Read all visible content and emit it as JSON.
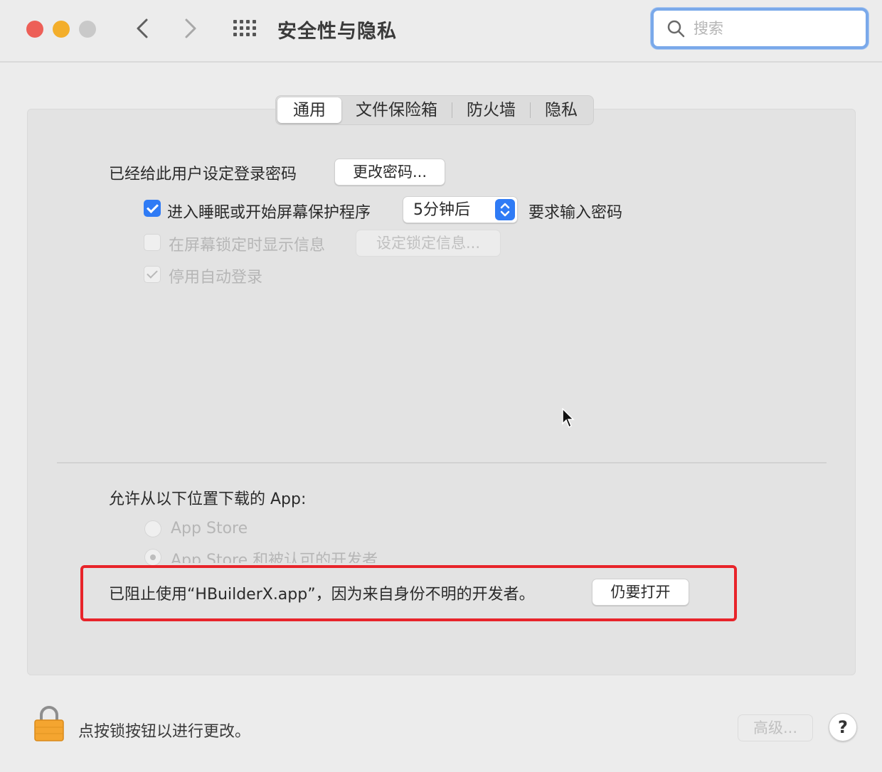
{
  "window": {
    "title": "安全性与隐私",
    "nav_back": "‹",
    "nav_forward": "›"
  },
  "search": {
    "placeholder": "搜索",
    "value": ""
  },
  "tabs": [
    {
      "label": "通用",
      "active": true
    },
    {
      "label": "文件保险箱",
      "active": false
    },
    {
      "label": "防火墙",
      "active": false
    },
    {
      "label": "隐私",
      "active": false
    }
  ],
  "general": {
    "password_set_label": "已经给此用户设定登录密码",
    "change_password_button": "更改密码...",
    "require_password": {
      "checked": true,
      "label": "进入睡眠或开始屏幕保护程序",
      "delay_value": "5分钟后",
      "suffix": "要求输入密码"
    },
    "show_message": {
      "checked": false,
      "label": "在屏幕锁定时显示信息",
      "button": "设定锁定信息..."
    },
    "disable_auto_login": {
      "checked": true,
      "label": "停用自动登录"
    }
  },
  "downloads": {
    "heading": "允许从以下位置下载的 App:",
    "options": [
      {
        "label": "App Store",
        "selected": false
      },
      {
        "label": "App Store 和被认可的开发者",
        "selected": true
      }
    ],
    "blocked_message": "已阻止使用“HBuilderX.app”，因为来自身份不明的开发者。",
    "open_anyway_button": "仍要打开"
  },
  "footer": {
    "lock_message": "点按锁按钮以进行更改。",
    "advanced_button": "高级...",
    "help_button": "?"
  },
  "colors": {
    "accent": "#2f7bf5",
    "highlight_border": "#e8242a",
    "close": "#ed5f57",
    "minimize": "#f3ae2b"
  }
}
